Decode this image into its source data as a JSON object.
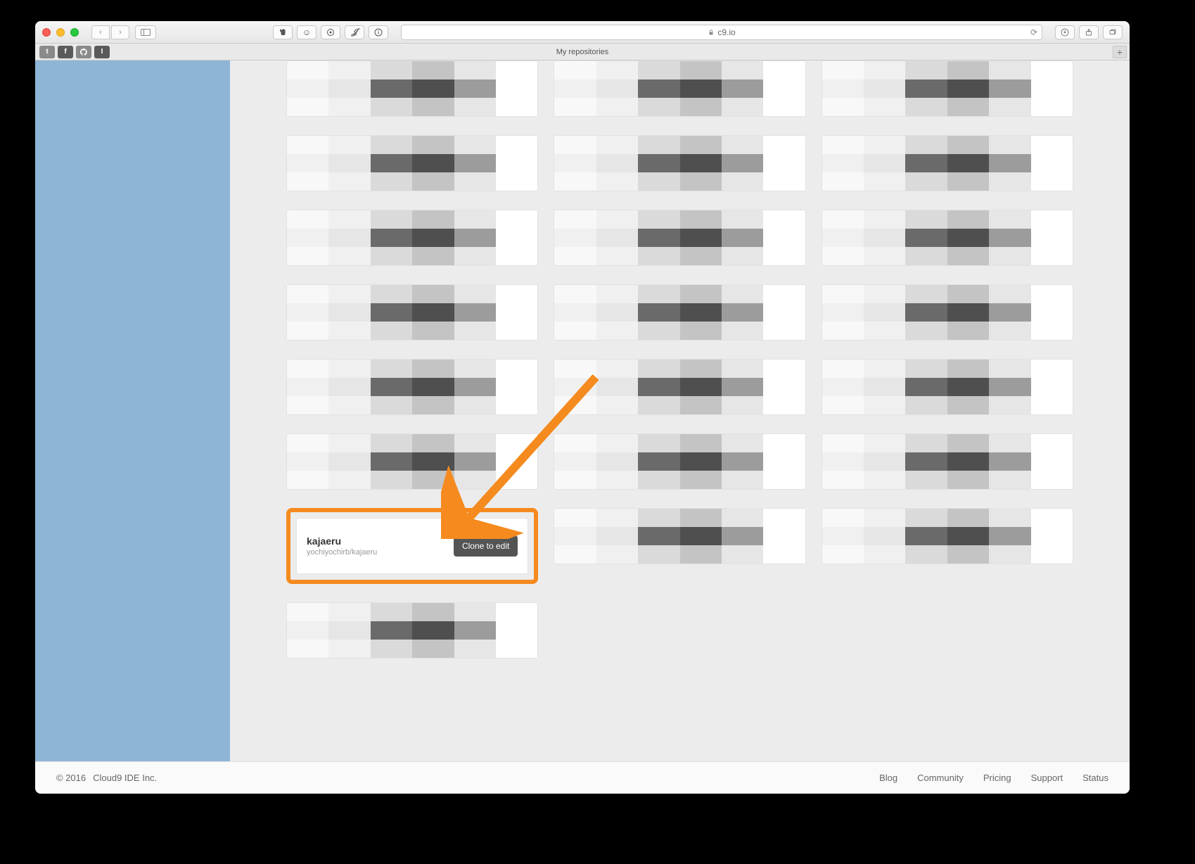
{
  "browser": {
    "url_host": "c9.io",
    "tab_title": "My repositories"
  },
  "highlighted_repo": {
    "name": "kajaeru",
    "path": "yochiyochirb/kajaeru",
    "clone_label": "Clone to edit"
  },
  "footer": {
    "copyright": "© 2016",
    "company": "Cloud9 IDE Inc.",
    "links": [
      "Blog",
      "Community",
      "Pricing",
      "Support",
      "Status"
    ]
  },
  "annotation": {
    "color": "#f58a1f"
  }
}
